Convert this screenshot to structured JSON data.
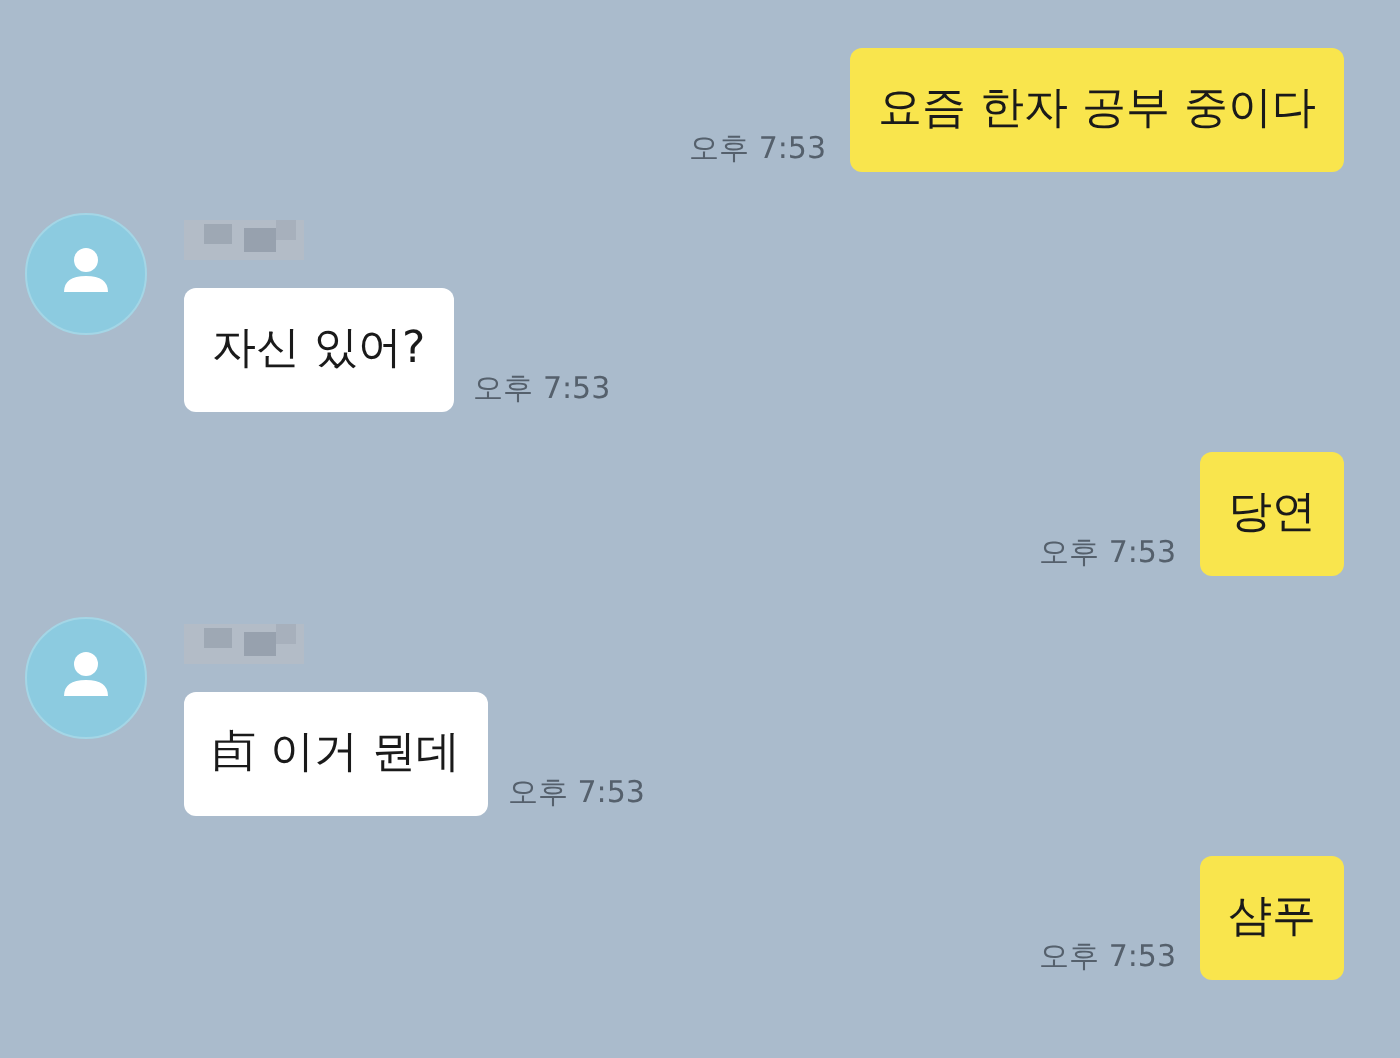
{
  "messages": [
    {
      "kind": "sent",
      "text": "요즘 한자 공부 중이다",
      "time": "오후 7:53"
    },
    {
      "kind": "received",
      "text": "자신 있어?",
      "time": "오후 7:53"
    },
    {
      "kind": "sent",
      "text": "당연",
      "time": "오후 7:53"
    },
    {
      "kind": "received",
      "text": "卣 이거 뭔데",
      "time": "오후 7:53"
    },
    {
      "kind": "sent",
      "text": "샴푸",
      "time": "오후 7:53"
    }
  ]
}
